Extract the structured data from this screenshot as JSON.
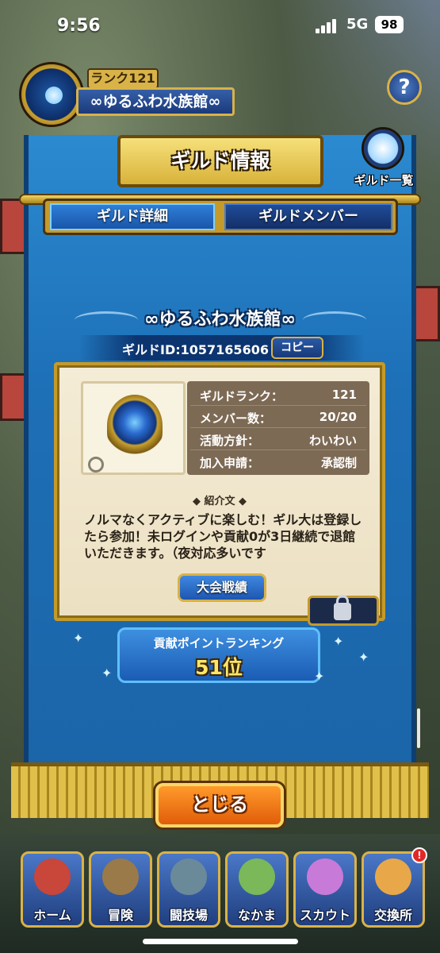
{
  "status_bar": {
    "time": "9:56",
    "network": "5G",
    "battery": "98"
  },
  "guild_header": {
    "rank_label": "ランク121",
    "guild_name": "∞ゆるふわ水族館∞",
    "help_icon": "question-icon"
  },
  "dialog": {
    "title": "ギルド情報",
    "list_button_label": "ギルド一覧",
    "tabs": [
      {
        "label": "ギルド詳細",
        "active": true
      },
      {
        "label": "ギルドメンバー",
        "active": false
      }
    ],
    "guild_name": "∞ゆるふわ水族館∞",
    "guild_id_label": "ギルドID:1057165606",
    "copy_label": "コピー",
    "info": [
      {
        "key": "ギルドランク：",
        "value": "121"
      },
      {
        "key": "メンバー数：",
        "value": "20/20"
      },
      {
        "key": "活動方針：",
        "value": "わいわい"
      },
      {
        "key": "加入申請：",
        "value": "承認制"
      }
    ],
    "intro_heading": "紹介文",
    "intro_text": "ノルマなくアクティブに楽しむ！ギル大は登録したら参加！未ログインや貢献0が3日継続で退館いただきます。（夜対応多いです",
    "record_button": "大会戦績",
    "ranking_title": "貢献ポイントランキング",
    "ranking_value": "51位",
    "close_button": "とじる"
  },
  "bottom_nav": [
    {
      "label": "ホーム",
      "icon": "home-tent-icon",
      "color": "#c8463a"
    },
    {
      "label": "冒険",
      "icon": "caravan-icon",
      "color": "#9a7a48"
    },
    {
      "label": "闘技場",
      "icon": "arena-icon",
      "color": "#6a8a9a"
    },
    {
      "label": "なかま",
      "icon": "monster-group-icon",
      "color": "#7ab85a"
    },
    {
      "label": "スカウト",
      "icon": "scout-icon",
      "color": "#c87ad8"
    },
    {
      "label": "交換所",
      "icon": "exchange-icon",
      "color": "#e8a84a",
      "badge": "!"
    }
  ]
}
